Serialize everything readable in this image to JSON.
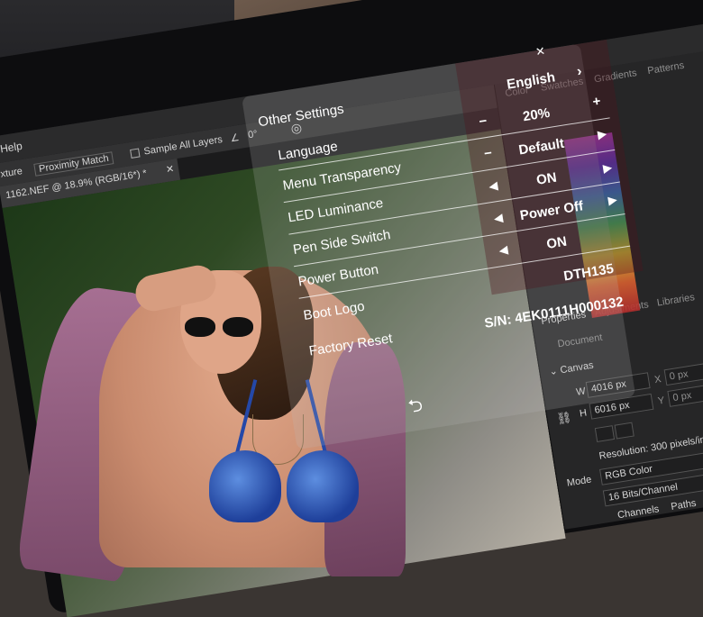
{
  "photoshop": {
    "menu_help": "Help",
    "options": {
      "texture": "xture",
      "proximity_match": "Proximity Match",
      "sample_all_layers": "Sample All Layers",
      "angle": "0°"
    },
    "document_tab": "1162.NEF @ 18.9% (RGB/16*) *",
    "panel_tabs": [
      "Color",
      "Swatches",
      "Gradients",
      "Patterns"
    ],
    "properties_tabs": [
      "Properties",
      "Adjustments",
      "Libraries"
    ],
    "properties_section": "Document",
    "canvas_label": "Canvas",
    "width_label": "W",
    "width_value": "4016 px",
    "height_label": "H",
    "height_value": "6016 px",
    "x_label": "X",
    "x_value": "0 px",
    "y_label": "Y",
    "y_value": "0 px",
    "resolution": "Resolution: 300 pixels/inch",
    "mode_label": "Mode",
    "mode_value": "RGB Color",
    "bits_value": "16 Bits/Channel",
    "bottom_tabs": [
      "Channels",
      "Paths"
    ]
  },
  "osd": {
    "title": "Other Settings",
    "language_value": "English",
    "rows": [
      {
        "label": "Language",
        "value": "20%",
        "dec": "−",
        "inc": "+"
      },
      {
        "label": "Menu Transparency",
        "value": "Default",
        "dec": "−",
        "inc": "▶"
      },
      {
        "label": "LED Luminance",
        "value": "ON",
        "dec": "◀",
        "inc": "▶"
      },
      {
        "label": "Pen Side Switch",
        "value": "Power Off",
        "dec": "◀",
        "inc": "▶"
      },
      {
        "label": "Power Button",
        "value": "ON",
        "dec": "◀",
        "inc": ""
      },
      {
        "label": "Boot Logo",
        "value": "DTH135",
        "dec": "",
        "inc": ""
      },
      {
        "label": "Factory Reset",
        "value": "S/N: 4EK0111H000132",
        "dec": "",
        "inc": ""
      }
    ],
    "back_icon": "return-icon"
  }
}
